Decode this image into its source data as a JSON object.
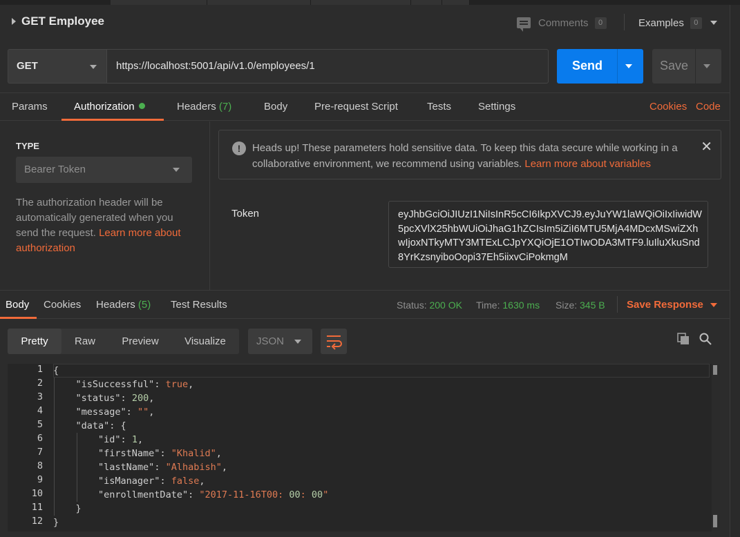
{
  "request": {
    "title": "GET Employee",
    "comments_label": "Comments",
    "comments_count": "0",
    "examples_label": "Examples",
    "examples_count": "0"
  },
  "url_bar": {
    "method": "GET",
    "url": "https://localhost:5001/api/v1.0/employees/1",
    "send_label": "Send",
    "save_label": "Save"
  },
  "request_tabs": {
    "params": "Params",
    "authorization": "Authorization",
    "headers": "Headers",
    "headers_count": "(7)",
    "body": "Body",
    "prerequest": "Pre-request Script",
    "tests": "Tests",
    "settings": "Settings",
    "cookies": "Cookies",
    "code": "Code"
  },
  "auth": {
    "type_label": "TYPE",
    "type_value": "Bearer Token",
    "description": "The authorization header will be automatically generated when you send the request. ",
    "learn_more": "Learn more about authorization",
    "warning": "Heads up! These parameters hold sensitive data. To keep this data secure while working in a collaborative environment, we recommend using variables. ",
    "warning_link": "Learn more about variables",
    "token_label": "Token",
    "token_value": "eyJhbGciOiJIUzI1NiIsInR5cCI6IkpXVCJ9.eyJuYW1laWQiOiIxIiwidW5pcXVlX25hbWUiOiJhaG1hZCIsIm5iZiI6MTU5MjA4MDcxMSwiZXhwIjoxNTkyMTY3MTExLCJpYXQiOjE1OTIwODA3MTF9.luIluXkuSnd8YrKzsnyiboOopi37Eh5iixvCiPokmgM"
  },
  "response_tabs": {
    "body": "Body",
    "cookies": "Cookies",
    "headers": "Headers",
    "headers_count": "(5)",
    "test_results": "Test Results"
  },
  "response_status": {
    "status_label": "Status:",
    "status_value": "200 OK",
    "time_label": "Time:",
    "time_value": "1630 ms",
    "size_label": "Size:",
    "size_value": "345 B",
    "save_response": "Save Response"
  },
  "view_modes": {
    "pretty": "Pretty",
    "raw": "Raw",
    "preview": "Preview",
    "visualize": "Visualize",
    "format": "JSON"
  },
  "code_lines": [
    {
      "n": "1",
      "text": "{"
    },
    {
      "n": "2",
      "text": "    \"isSuccessful\": true,"
    },
    {
      "n": "3",
      "text": "    \"status\": 200,"
    },
    {
      "n": "4",
      "text": "    \"message\": \"\","
    },
    {
      "n": "5",
      "text": "    \"data\": {"
    },
    {
      "n": "6",
      "text": "        \"id\": 1,"
    },
    {
      "n": "7",
      "text": "        \"firstName\": \"Khalid\","
    },
    {
      "n": "8",
      "text": "        \"lastName\": \"Alhabish\","
    },
    {
      "n": "9",
      "text": "        \"isManager\": false,"
    },
    {
      "n": "10",
      "text": "        \"enrollmentDate\": \"2017-11-16T00:00:00\""
    },
    {
      "n": "11",
      "text": "    }"
    },
    {
      "n": "12",
      "text": "}"
    }
  ],
  "colors": {
    "accent": "#f26b3a",
    "send": "#097bed",
    "success": "#4caf50"
  }
}
